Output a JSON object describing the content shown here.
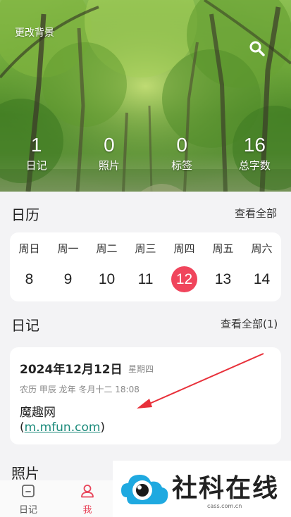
{
  "header": {
    "change_background_label": "更改背景",
    "search_icon": "search-icon"
  },
  "stats": [
    {
      "value": "1",
      "label": "日记"
    },
    {
      "value": "0",
      "label": "照片"
    },
    {
      "value": "0",
      "label": "标签"
    },
    {
      "value": "16",
      "label": "总字数"
    }
  ],
  "calendar": {
    "title": "日历",
    "view_all_label": "查看全部",
    "weekdays": [
      "周日",
      "周一",
      "周二",
      "周三",
      "周四",
      "周五",
      "周六"
    ],
    "days": [
      "8",
      "9",
      "10",
      "11",
      "12",
      "13",
      "14"
    ],
    "today_index": 4
  },
  "diary_section": {
    "title": "日记",
    "view_all_label": "查看全部(1)",
    "entry": {
      "date": "2024年12月12日",
      "weekday": "星期四",
      "lunar": "农历  甲辰 龙年 冬月十二  18:08",
      "title": "魔趣网",
      "link_prefix": "(",
      "link_url": "m.mfun.com",
      "link_suffix": ")"
    }
  },
  "photos_section": {
    "title": "照片"
  },
  "bottom_nav": {
    "items": [
      {
        "label": "日记",
        "icon": "diary-icon"
      },
      {
        "label": "我",
        "icon": "person-icon"
      }
    ]
  },
  "watermark": {
    "brand": "社科在线",
    "domain": "cass.com.cn"
  },
  "colors": {
    "accent": "#f0455c",
    "link": "#1a8a7a",
    "arrow": "#e8303a"
  }
}
